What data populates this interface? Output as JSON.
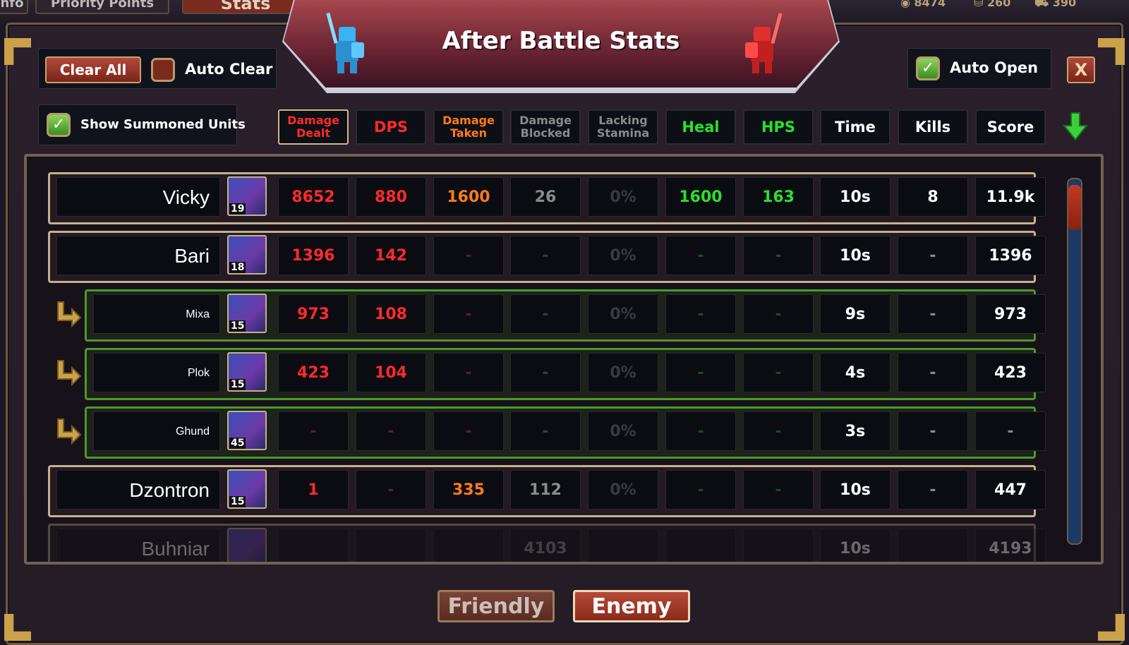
{
  "hud": {
    "tabs": [
      "nfo",
      "Priority Points",
      "Stats"
    ],
    "resources": [
      "8474",
      "260",
      "390"
    ]
  },
  "title": "After Battle Stats",
  "controls": {
    "clear_all": "Clear All",
    "auto_clear": "Auto Clear",
    "auto_open": "Auto Open",
    "close": "X",
    "show_summoned": "Show Summoned Units"
  },
  "columns": [
    {
      "line1": "Damage",
      "line2": "Dealt",
      "color": "#ff2a2a"
    },
    {
      "line1": "DPS",
      "line2": "",
      "color": "#ff2a2a"
    },
    {
      "line1": "Damage",
      "line2": "Taken",
      "color": "#ff7a1a"
    },
    {
      "line1": "Damage",
      "line2": "Blocked",
      "color": "#8a8a8a"
    },
    {
      "line1": "Lacking",
      "line2": "Stamina",
      "color": "#8a8a8a"
    },
    {
      "line1": "Heal",
      "line2": "",
      "color": "#2ae02a"
    },
    {
      "line1": "HPS",
      "line2": "",
      "color": "#2ae02a"
    },
    {
      "line1": "Time",
      "line2": "",
      "color": "#ffffff"
    },
    {
      "line1": "Kills",
      "line2": "",
      "color": "#ffffff"
    },
    {
      "line1": "Score",
      "line2": "",
      "color": "#ffffff"
    }
  ],
  "rows": [
    {
      "name": "Vicky",
      "level": "19",
      "type": "main",
      "values": [
        "8652",
        "880",
        "1600",
        "26",
        "0%",
        "1600",
        "163",
        "10s",
        "8",
        "11.9k"
      ]
    },
    {
      "name": "Bari",
      "level": "18",
      "type": "main",
      "values": [
        "1396",
        "142",
        "-",
        "-",
        "0%",
        "-",
        "-",
        "10s",
        "-",
        "1396"
      ]
    },
    {
      "name": "Mixa",
      "level": "15",
      "type": "summon",
      "values": [
        "973",
        "108",
        "-",
        "-",
        "0%",
        "-",
        "-",
        "9s",
        "-",
        "973"
      ]
    },
    {
      "name": "Plok",
      "level": "15",
      "type": "summon",
      "values": [
        "423",
        "104",
        "-",
        "-",
        "0%",
        "-",
        "-",
        "4s",
        "-",
        "423"
      ]
    },
    {
      "name": "Ghund",
      "level": "45",
      "type": "summon",
      "values": [
        "-",
        "-",
        "-",
        "-",
        "0%",
        "-",
        "-",
        "3s",
        "-",
        "-"
      ]
    },
    {
      "name": "Dzontron",
      "level": "15",
      "type": "main",
      "values": [
        "1",
        "-",
        "335",
        "112",
        "0%",
        "-",
        "-",
        "10s",
        "-",
        "447"
      ]
    },
    {
      "name": "Buhniar",
      "level": "",
      "type": "main",
      "values": [
        "",
        "",
        "",
        "4103",
        "",
        "",
        "",
        "10s",
        "",
        "4193"
      ]
    }
  ],
  "footer": {
    "friendly": "Friendly",
    "enemy": "Enemy"
  }
}
